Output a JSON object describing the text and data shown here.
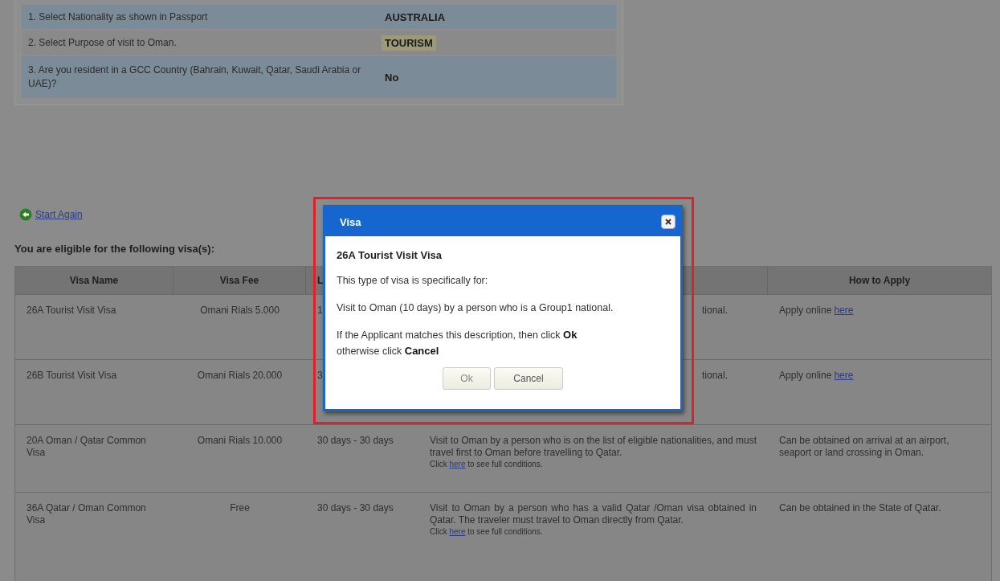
{
  "criteria": [
    {
      "label": "1. Select Nationality as shown in Passport",
      "value": "AUSTRALIA",
      "highlighted": false
    },
    {
      "label": "2. Select Purpose of visit to Oman.",
      "value": "TOURISM",
      "highlighted": true
    },
    {
      "label": "3. Are you resident in a GCC Country (Bahrain, Kuwait, Qatar, Saudi Arabia or UAE)?",
      "value": "No",
      "highlighted": false
    }
  ],
  "start_again": "Start Again",
  "eligible_heading": "You are eligible for the following visa(s):",
  "table": {
    "header": {
      "visa_name": "Visa Name",
      "visa_fee": "Visa Fee",
      "column_3": "L",
      "how_to_apply": "How to Apply"
    },
    "rows": [
      {
        "visa_name": "26A Tourist Visit Visa",
        "visa_fee": "Omani Rials 5.000",
        "column_3": "1",
        "column_4": {
          "text": "tional."
        },
        "how_to_apply": {
          "text": "Apply online",
          "link": "here"
        }
      },
      {
        "visa_name": "26B Tourist Visit Visa",
        "visa_fee": "Omani Rials 20.000",
        "column_3": "3",
        "column_4": {
          "text": "tional."
        },
        "how_to_apply": {
          "text": "Apply online",
          "link": "here"
        }
      },
      {
        "visa_name": "20A Oman / Qatar Common Visa",
        "visa_fee": "Omani Rials 10.000",
        "column_3": "30 days - 30 days",
        "column_4": {
          "text": "Visit to Oman by a person who is on the list of eligible nationalities, and must travel first to Oman before travelling to Qatar.",
          "note_before": "Click",
          "link": "here",
          "note_after": "to see full conditions."
        },
        "how_to_apply": {
          "text": "Can be obtained on arrival at an airport, seaport or land crossing in Oman."
        }
      },
      {
        "visa_name": "36A Qatar / Oman Common Visa",
        "visa_fee": "Free",
        "column_3": "30 days - 30 days",
        "column_4": {
          "text": "Visit to Oman by a person who has a valid Qatar /Oman visa obtained in Qatar. The traveler must travel to Oman directly from Qatar.",
          "note_before": "Click",
          "link": "here",
          "note_after": "to see full conditions."
        },
        "how_to_apply": {
          "text": "Can be obtained in the State of Qatar."
        }
      }
    ]
  },
  "dialog": {
    "title": "Visa",
    "heading": "26A Tourist Visit Visa",
    "paragraphs": [
      "This type of visa is specifically for:",
      "Visit to Oman (10 days) by a person who is a Group1 national."
    ],
    "instruction": "If the Applicant matches this description, then click  **Ok**\notherwise click  **Cancel**",
    "buttons": [
      "Ok",
      "Cancel"
    ]
  }
}
